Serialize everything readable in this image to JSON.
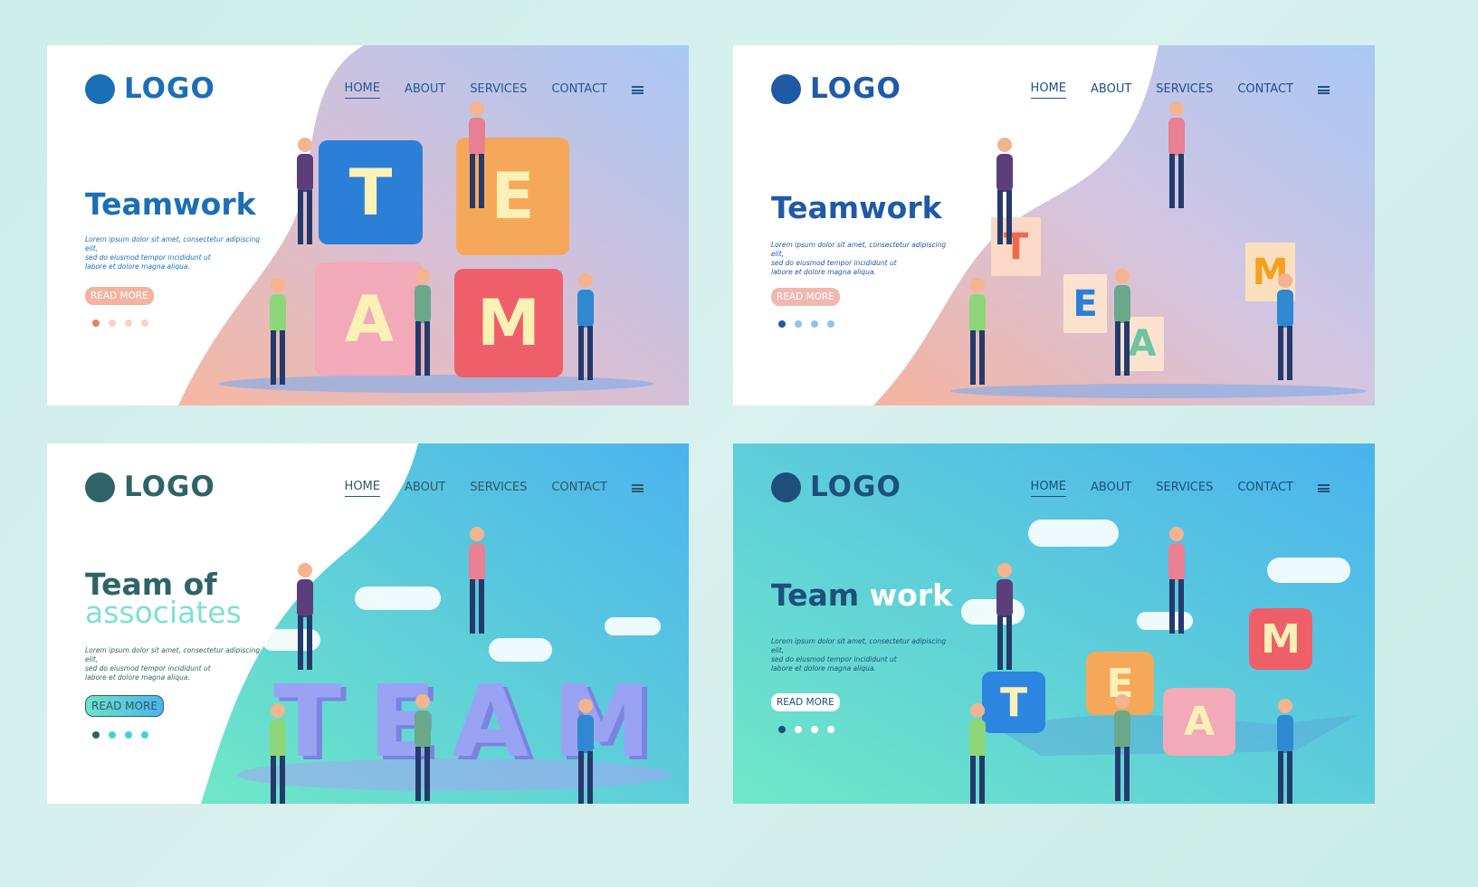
{
  "colors": {
    "page_bg": "#d3efeb"
  },
  "panels": [
    {
      "logo": "LOGO",
      "nav": [
        "HOME",
        "ABOUT",
        "SERVICES",
        "CONTACT"
      ],
      "title": "Teamwork",
      "title_accent": "",
      "description": [
        "Lorem ipsum dolor sit amet, consectetur adipiscing elit,",
        "sed do eiusmod tempor incididunt ut",
        "labore et dolore magna aliqua."
      ],
      "button": "READ MORE",
      "letters": [
        "T",
        "E",
        "A",
        "M"
      ],
      "slides": 4,
      "active_slide": 1,
      "colors": {
        "brand": "#1b6fb5",
        "nav": "#1f5a96",
        "button": "#f2b3a0",
        "dot_active": "#e8825f",
        "dot": "#f6d2c6",
        "tiles": [
          "#2c7fd6",
          "#f6a85a",
          "#f2a9b8",
          "#ef5f6a"
        ]
      }
    },
    {
      "logo": "LOGO",
      "nav": [
        "HOME",
        "ABOUT",
        "SERVICES",
        "CONTACT"
      ],
      "title": "Teamwork",
      "title_accent": "",
      "description": [
        "Lorem ipsum dolor sit amet, consectetur adipiscing elit,",
        "sed do eiusmod tempor incididunt ut",
        "labore et dolore magna aliqua."
      ],
      "button": "READ MORE",
      "letters": [
        "T",
        "E",
        "A",
        "M"
      ],
      "slides": 4,
      "active_slide": 1,
      "colors": {
        "brand": "#1f5aa6",
        "nav": "#1f4f8a",
        "button": "#f2b8b0",
        "dot_active": "#1f5aa6",
        "dot": "#8fc3e8",
        "tiles": [
          "#fbd9c6",
          "#fbe3cf",
          "#fbe3cf",
          "#fbe0c0"
        ]
      }
    },
    {
      "logo": "LOGO",
      "nav": [
        "HOME",
        "ABOUT",
        "SERVICES",
        "CONTACT"
      ],
      "title": "Team of",
      "title_accent": "associates",
      "description": [
        "Lorem ipsum dolor sit amet, consectetur adipiscing elit,",
        "sed do eiusmod tempor incididunt ut",
        "labore et dolore magna aliqua."
      ],
      "button": "READ MORE",
      "letters": [
        "T",
        "E",
        "A",
        "M"
      ],
      "slides": 4,
      "active_slide": 1,
      "colors": {
        "brand": "#2e6468",
        "nav": "#2e5a66",
        "button": "#5fd6d0",
        "dot_active": "#2d6166",
        "dot": "#43d3d3",
        "tiles": [
          "#9aa3f3",
          "#9aa3f3",
          "#9aa3f3",
          "#9aa3f3"
        ]
      }
    },
    {
      "logo": "LOGO",
      "nav": [
        "HOME",
        "ABOUT",
        "SERVICES",
        "CONTACT"
      ],
      "title": "Team",
      "title_accent": "work",
      "description": [
        "Lorem ipsum dolor sit amet, consectetur adipiscing elit,",
        "sed do eiusmod tempor incididunt ut",
        "labore et dolore magna aliqua."
      ],
      "button": "READ MORE",
      "letters": [
        "T",
        "E",
        "A",
        "M"
      ],
      "slides": 4,
      "active_slide": 1,
      "colors": {
        "brand": "#1e4f7a",
        "nav": "#1e4f7a",
        "button": "#ffffff",
        "dot_active": "#1e4f7a",
        "dot": "#ffffff",
        "tiles": [
          "#2c86e0",
          "#f6a85a",
          "#f2a9b8",
          "#ef5f6a"
        ]
      }
    }
  ]
}
